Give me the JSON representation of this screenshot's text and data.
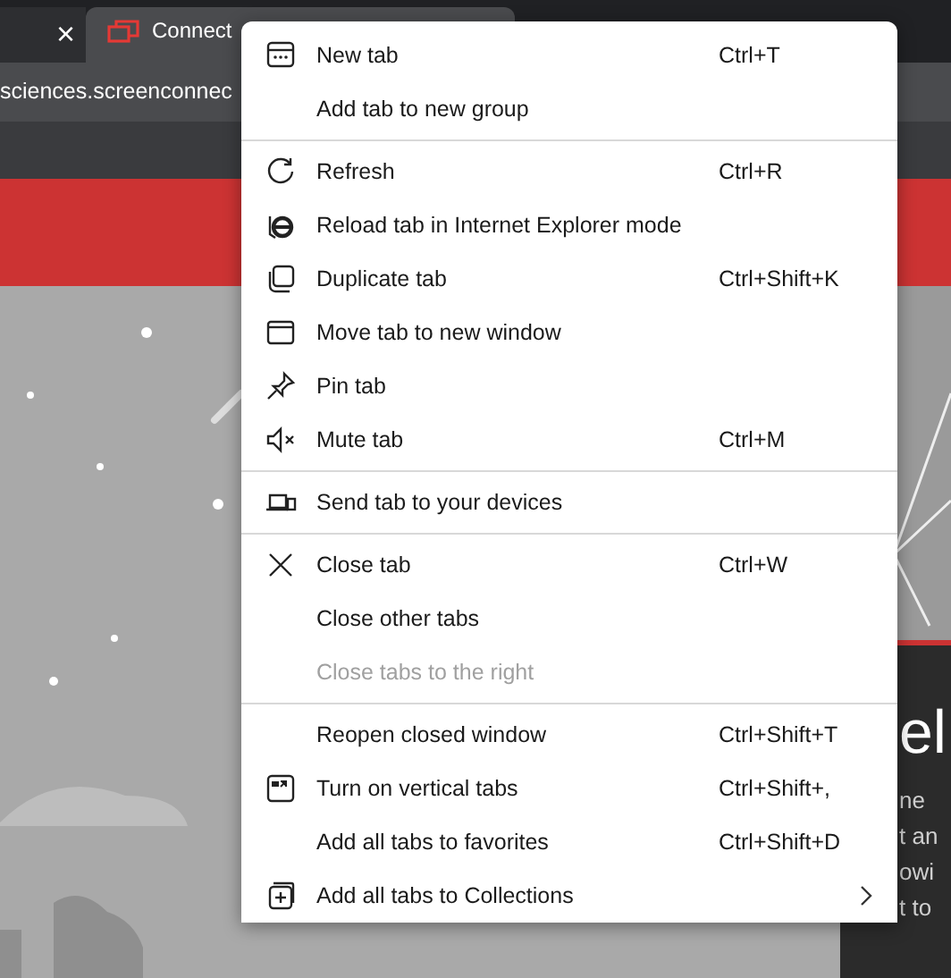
{
  "browser": {
    "tab_close": "×",
    "tab_title": "Connect",
    "address": "sciences.screenconnec"
  },
  "page": {
    "heading": "el",
    "lines": [
      "ne",
      "t an",
      "owi",
      "t to"
    ]
  },
  "menu": {
    "groups": [
      {
        "items": [
          {
            "kind": "newtab",
            "label": "New tab",
            "shortcut": "Ctrl+T",
            "disabled": false
          },
          {
            "kind": "plain",
            "label": "Add tab to new group",
            "disabled": false
          }
        ]
      },
      {
        "items": [
          {
            "kind": "refresh",
            "label": "Refresh",
            "shortcut": "Ctrl+R",
            "disabled": false
          },
          {
            "kind": "ie",
            "label": "Reload tab in Internet Explorer mode",
            "disabled": false
          },
          {
            "kind": "duplicate",
            "label": "Duplicate tab",
            "shortcut": "Ctrl+Shift+K",
            "disabled": false
          },
          {
            "kind": "window",
            "label": "Move tab to new window",
            "disabled": false
          },
          {
            "kind": "pin",
            "label": "Pin tab",
            "disabled": false
          },
          {
            "kind": "mute",
            "label": "Mute tab",
            "shortcut": "Ctrl+M",
            "disabled": false
          }
        ]
      },
      {
        "items": [
          {
            "kind": "devices",
            "label": "Send tab to your devices",
            "disabled": false
          }
        ]
      },
      {
        "items": [
          {
            "kind": "close",
            "label": "Close tab",
            "shortcut": "Ctrl+W",
            "disabled": false
          },
          {
            "kind": "plain",
            "label": "Close other tabs",
            "disabled": false
          },
          {
            "kind": "plain",
            "label": "Close tabs to the right",
            "disabled": true
          }
        ]
      },
      {
        "items": [
          {
            "kind": "plain",
            "label": "Reopen closed window",
            "shortcut": "Ctrl+Shift+T",
            "disabled": false
          },
          {
            "kind": "vertical",
            "label": "Turn on vertical tabs",
            "shortcut": "Ctrl+Shift+,",
            "disabled": false
          },
          {
            "kind": "plain",
            "label": "Add all tabs to favorites",
            "shortcut": "Ctrl+Shift+D",
            "disabled": false
          },
          {
            "kind": "collections",
            "label": "Add all tabs to Collections",
            "submenu": true,
            "disabled": false
          }
        ]
      }
    ]
  }
}
